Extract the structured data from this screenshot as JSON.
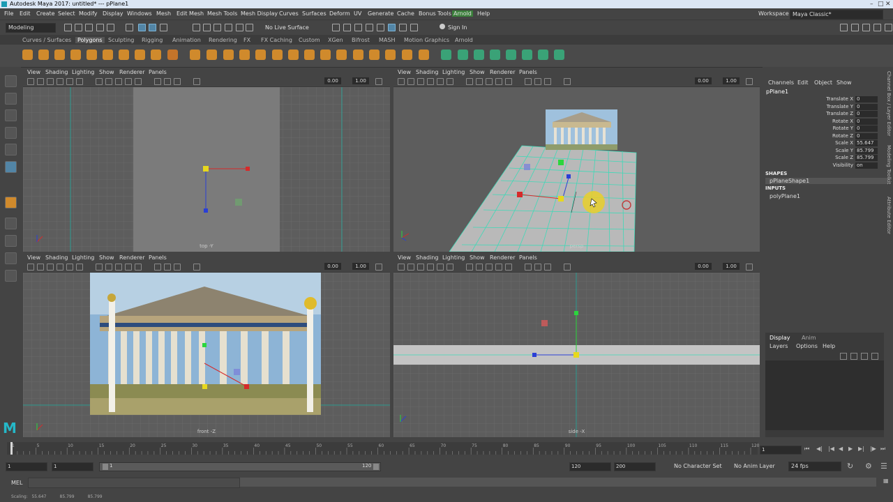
{
  "title": "Autodesk Maya 2017: untitled*   ---   pPlane1",
  "menu": [
    "File",
    "Edit",
    "Create",
    "Select",
    "Modify",
    "Display",
    "Windows",
    "Mesh",
    "Edit Mesh",
    "Mesh Tools",
    "Mesh Display",
    "Curves",
    "Surfaces",
    "Deform",
    "UV",
    "Generate",
    "Cache",
    "Bonus Tools",
    "Arnold",
    "Help"
  ],
  "workspace_label": "Workspace :",
  "workspace_value": "Maya Classic*",
  "mode_menu": "Modeling",
  "live_surface": "No Live Surface",
  "sign_in": "Sign In",
  "shelf_tabs": [
    "Curves / Surfaces",
    "Polygons",
    "Sculpting",
    "Rigging",
    "Animation",
    "Rendering",
    "FX",
    "FX Caching",
    "Custom",
    "XGen",
    "Bifrost",
    "MASH",
    "Motion Graphics",
    "Arnold"
  ],
  "shelf_active": "Polygons",
  "panel_menu": [
    "View",
    "Shading",
    "Lighting",
    "Show",
    "Renderer",
    "Panels"
  ],
  "panel_field_a": "0.00",
  "panel_field_b": "1.00",
  "views": {
    "top": "top -Y",
    "persp": "persp",
    "front": "front -Z",
    "side": "side -X"
  },
  "channel_box": {
    "tabs": [
      "Channels",
      "Edit",
      "Object",
      "Show"
    ],
    "object": "pPlane1",
    "attrs": [
      {
        "label": "Translate X",
        "value": "0"
      },
      {
        "label": "Translate Y",
        "value": "0"
      },
      {
        "label": "Translate Z",
        "value": "0"
      },
      {
        "label": "Rotate X",
        "value": "0"
      },
      {
        "label": "Rotate Y",
        "value": "0"
      },
      {
        "label": "Rotate Z",
        "value": "0"
      },
      {
        "label": "Scale X",
        "value": "55.647"
      },
      {
        "label": "Scale Y",
        "value": "85.799"
      },
      {
        "label": "Scale Z",
        "value": "85.799"
      },
      {
        "label": "Visibility",
        "value": "on"
      }
    ],
    "shapes_header": "SHAPES",
    "shape": "pPlaneShape1",
    "inputs_header": "INPUTS",
    "input": "polyPlane1",
    "side_tabs": [
      "Channel Box / Layer Editor",
      "Modeling Toolkit",
      "Attribute Editor"
    ]
  },
  "layer_editor": {
    "tabs": [
      "Display",
      "Anim"
    ],
    "menu": [
      "Layers",
      "Options",
      "Help"
    ]
  },
  "timeline": {
    "ticks": [
      "1",
      "5",
      "10",
      "15",
      "20",
      "25",
      "30",
      "35",
      "40",
      "45",
      "50",
      "55",
      "60",
      "65",
      "70",
      "75",
      "80",
      "85",
      "90",
      "95",
      "100",
      "105",
      "110",
      "115",
      "120"
    ],
    "current_frame": "1"
  },
  "range": {
    "start": "1",
    "inner_start": "1",
    "slider_start": "1",
    "slider_end": "120",
    "inner_end": "120",
    "end": "200",
    "character_set": "No Character Set",
    "anim_layer": "No Anim Layer",
    "fps": "24 fps"
  },
  "cmd_label": "MEL",
  "help_line": "Scaling:   55.647          85.799          85.799"
}
